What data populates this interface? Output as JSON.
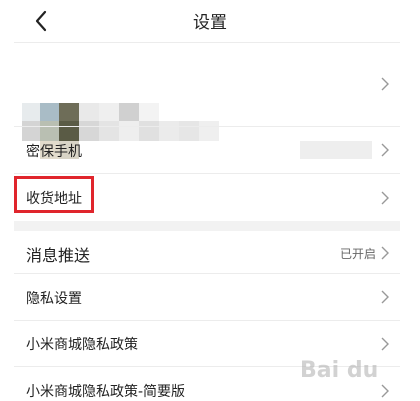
{
  "header": {
    "title": "设置",
    "back_icon": "chevron-left-icon"
  },
  "profile": {
    "avatar": "pixelated-avatar"
  },
  "rows": {
    "security_phone": {
      "label": "密保手机"
    },
    "shipping_address": {
      "label": "收货地址"
    },
    "push_notifications": {
      "label": "消息推送",
      "value": "已开启"
    },
    "privacy_settings": {
      "label": "隐私设置"
    },
    "mi_store_privacy_policy": {
      "label": "小米商城隐私政策"
    },
    "mi_store_privacy_policy_brief": {
      "label": "小米商城隐私政策-简要版"
    }
  },
  "watermark": "Bai du",
  "colors": {
    "highlight_border": "#e0252c",
    "chevron": "#999999",
    "separator": "#ececec",
    "section_gap": "#f2f2f2"
  }
}
